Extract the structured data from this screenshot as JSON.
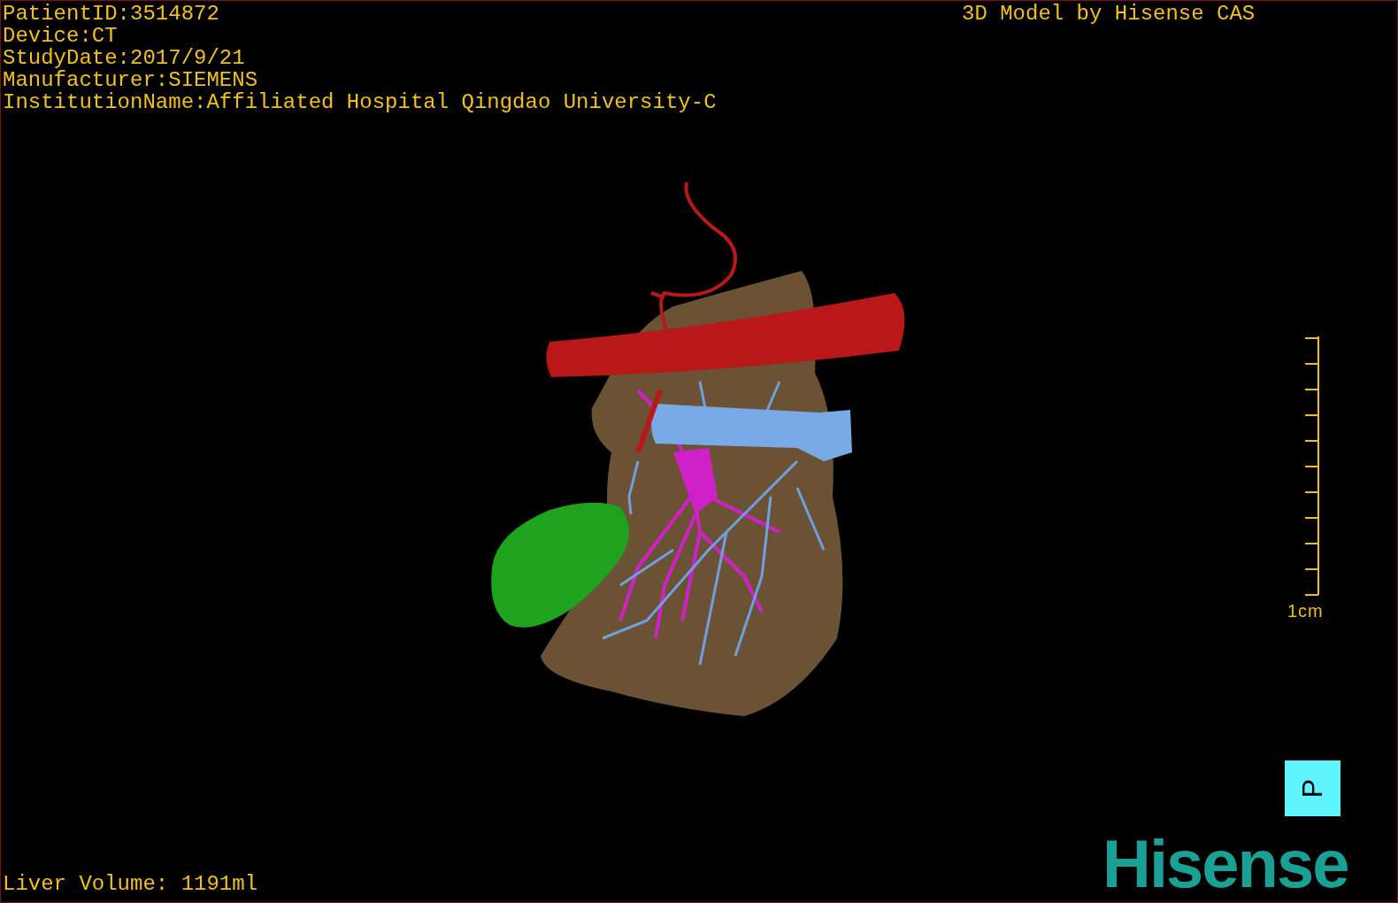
{
  "info_lines": [
    "PatientID:3514872",
    "Device:CT",
    "StudyDate:2017/9/21",
    "Manufacturer:SIEMENS",
    "InstitutionName:Affiliated Hospital Qingdao University-C"
  ],
  "title": "3D Model by Hisense CAS",
  "scale_bar": {
    "label": "1cm"
  },
  "orientation_marker": {
    "label": "P"
  },
  "logo": "Hisense",
  "liver_volume": "Liver Volume: 1191ml"
}
